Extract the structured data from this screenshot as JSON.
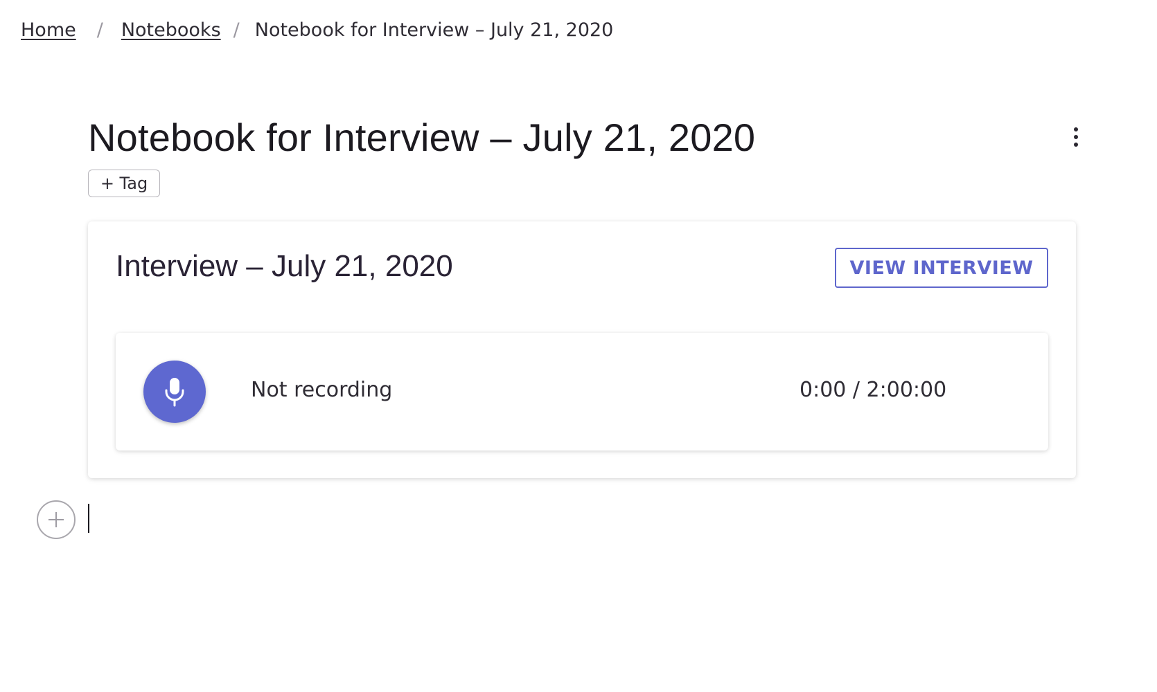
{
  "breadcrumb": {
    "home": "Home",
    "separator": "/",
    "notebooks": "Notebooks",
    "current": "Notebook for Interview – July 21, 2020"
  },
  "page": {
    "title": "Notebook for Interview – July 21, 2020",
    "tag_button": "+ Tag",
    "more_icon": "kebab-vertical-icon"
  },
  "interview_card": {
    "title": "Interview – July 21, 2020",
    "view_button": "VIEW INTERVIEW",
    "recorder": {
      "mic_icon": "microphone-icon",
      "status": "Not recording",
      "time": "0:00 / 2:00:00"
    }
  },
  "editor": {
    "add_icon": "plus-icon"
  },
  "colors": {
    "accent": "#5e66cc",
    "mic_fill": "#5e68d0",
    "text": "#2f2c34"
  }
}
